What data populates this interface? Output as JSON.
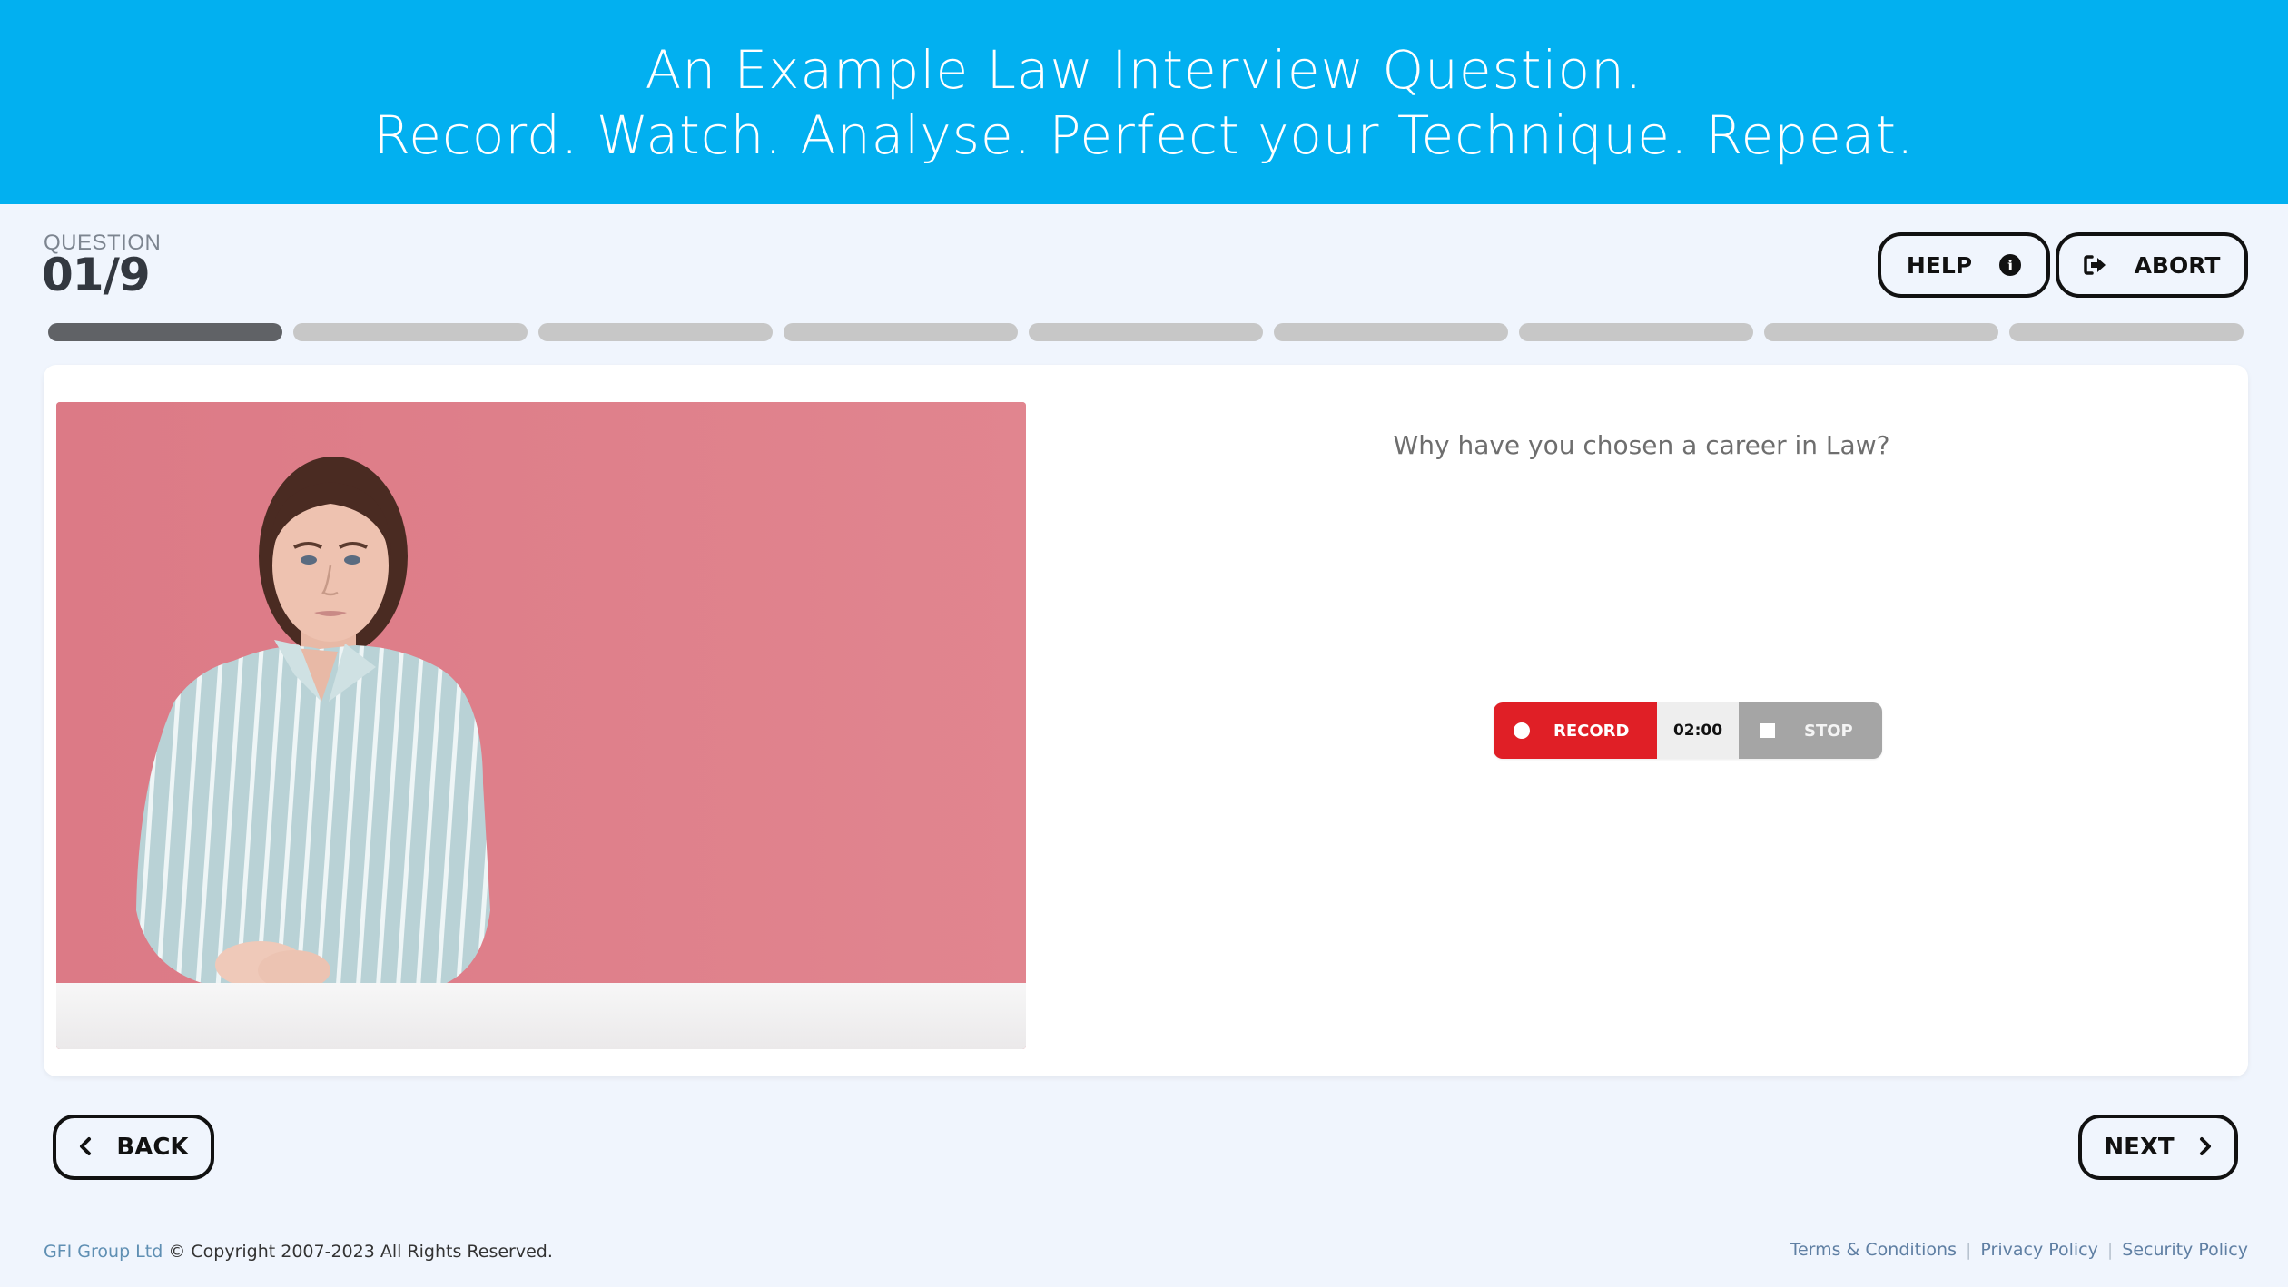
{
  "banner": {
    "line1": "An Example Law Interview Question.",
    "line2": "Record. Watch. Analyse. Perfect your Technique. Repeat.",
    "background_color": "#02b0f0"
  },
  "question_header": {
    "label": "QUESTION",
    "number": "01/9",
    "current": 1,
    "total": 9
  },
  "top_buttons": {
    "help": {
      "label": "HELP",
      "icon": "info-circle-icon"
    },
    "abort": {
      "label": "ABORT",
      "icon": "sign-out-icon"
    }
  },
  "progress": {
    "segments_total": 9,
    "segments_completed": 1
  },
  "main": {
    "interviewer_image": "woman-in-striped-shirt-seated-at-table-pink-background",
    "question_text": "Why have you chosen a career in Law?",
    "recorder": {
      "record_label": "RECORD",
      "timer": "02:00",
      "stop_label": "STOP",
      "record_color": "#e01f26",
      "stop_color": "#a5a5a5"
    }
  },
  "navigation": {
    "back_label": "BACK",
    "next_label": "NEXT"
  },
  "footer": {
    "brand": "GFI Group Ltd",
    "copyright": "© Copyright 2007-2023 All Rights Reserved.",
    "links": [
      "Terms & Conditions",
      "Privacy Policy",
      "Security Policy"
    ],
    "separator": "|"
  }
}
